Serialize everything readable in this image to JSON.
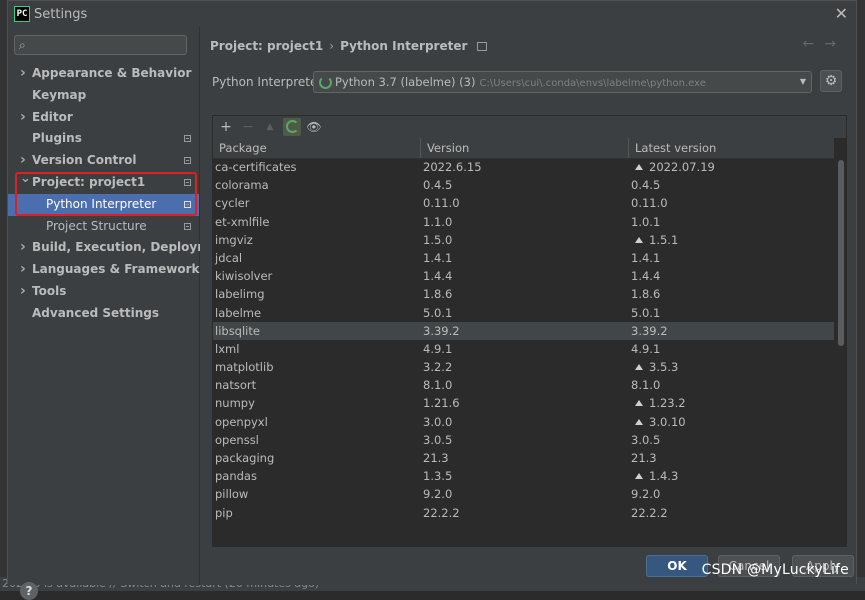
{
  "window": {
    "title": "Settings"
  },
  "sidebar": {
    "search_placeholder": "",
    "items": [
      {
        "label": "Appearance & Behavior",
        "has_chevron": true,
        "expanded": false
      },
      {
        "label": "Keymap"
      },
      {
        "label": "Editor",
        "has_chevron": true
      },
      {
        "label": "Plugins",
        "marker": true
      },
      {
        "label": "Version Control",
        "has_chevron": true,
        "marker": true
      },
      {
        "label": "Project: project1",
        "has_chevron": true,
        "expanded": true,
        "marker": true
      },
      {
        "label": "Python Interpreter",
        "child": true,
        "selected": true,
        "marker": true
      },
      {
        "label": "Project Structure",
        "child": true,
        "marker": true
      },
      {
        "label": "Build, Execution, Deployment",
        "has_chevron": true
      },
      {
        "label": "Languages & Frameworks",
        "has_chevron": true
      },
      {
        "label": "Tools",
        "has_chevron": true
      },
      {
        "label": "Advanced Settings"
      }
    ]
  },
  "breadcrumb": {
    "project": "Project: project1",
    "separator": "›",
    "page": "Python Interpreter"
  },
  "interpreter": {
    "label": "Python Interpreter:",
    "name": "Python 3.7 (labelme) (3)",
    "path": "C:\\Users\\cui\\.conda\\envs\\labelme\\python.exe"
  },
  "table": {
    "headers": [
      "Package",
      "Version",
      "Latest version"
    ],
    "rows": [
      {
        "package": "ca-certificates",
        "version": "2022.6.15",
        "latest": "2022.07.19",
        "upgrade": true
      },
      {
        "package": "colorama",
        "version": "0.4.5",
        "latest": "0.4.5",
        "upgrade": false
      },
      {
        "package": "cycler",
        "version": "0.11.0",
        "latest": "0.11.0",
        "upgrade": false
      },
      {
        "package": "et-xmlfile",
        "version": "1.1.0",
        "latest": "1.0.1",
        "upgrade": false
      },
      {
        "package": "imgviz",
        "version": "1.5.0",
        "latest": "1.5.1",
        "upgrade": true
      },
      {
        "package": "jdcal",
        "version": "1.4.1",
        "latest": "1.4.1",
        "upgrade": false
      },
      {
        "package": "kiwisolver",
        "version": "1.4.4",
        "latest": "1.4.4",
        "upgrade": false
      },
      {
        "package": "labelimg",
        "version": "1.8.6",
        "latest": "1.8.6",
        "upgrade": false
      },
      {
        "package": "labelme",
        "version": "5.0.1",
        "latest": "5.0.1",
        "upgrade": false
      },
      {
        "package": "libsqlite",
        "version": "3.39.2",
        "latest": "3.39.2",
        "upgrade": false,
        "selected": true
      },
      {
        "package": "lxml",
        "version": "4.9.1",
        "latest": "4.9.1",
        "upgrade": false
      },
      {
        "package": "matplotlib",
        "version": "3.2.2",
        "latest": "3.5.3",
        "upgrade": true
      },
      {
        "package": "natsort",
        "version": "8.1.0",
        "latest": "8.1.0",
        "upgrade": false
      },
      {
        "package": "numpy",
        "version": "1.21.6",
        "latest": "1.23.2",
        "upgrade": true
      },
      {
        "package": "openpyxl",
        "version": "3.0.0",
        "latest": "3.0.10",
        "upgrade": true
      },
      {
        "package": "openssl",
        "version": "3.0.5",
        "latest": "3.0.5",
        "upgrade": false
      },
      {
        "package": "packaging",
        "version": "21.3",
        "latest": "21.3",
        "upgrade": false
      },
      {
        "package": "pandas",
        "version": "1.3.5",
        "latest": "1.4.3",
        "upgrade": true
      },
      {
        "package": "pillow",
        "version": "9.2.0",
        "latest": "9.2.0",
        "upgrade": false
      },
      {
        "package": "pip",
        "version": "22.2.2",
        "latest": "22.2.2",
        "upgrade": false
      }
    ]
  },
  "buttons": {
    "ok": "OK",
    "cancel": "Cancel",
    "apply": "Apply",
    "help": "?"
  },
  "watermark": "CSDN @MyLuckyLife",
  "status_bar": "2022.3 is available // Switch and restart (20 minutes ago)"
}
